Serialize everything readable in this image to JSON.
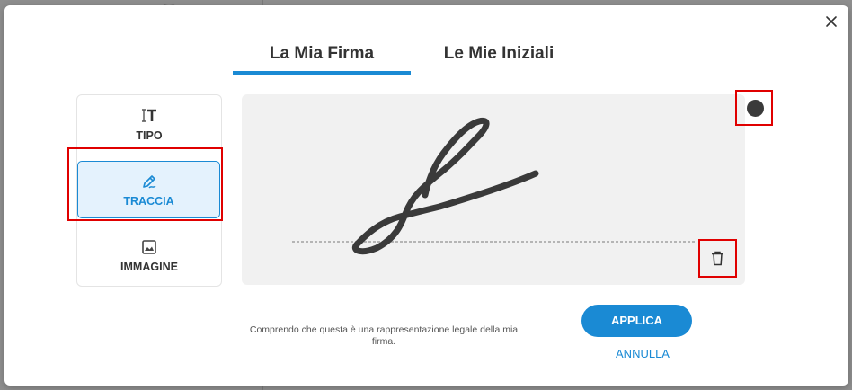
{
  "modal": {
    "tabs": [
      {
        "label": "La Mia Firma",
        "selected": true
      },
      {
        "label": "Le Mie Iniziali",
        "selected": false
      }
    ],
    "modes": [
      {
        "label": "TIPO",
        "icon": "text-type-icon",
        "selected": false
      },
      {
        "label": "TRACCIA",
        "icon": "draw-pen-icon",
        "selected": true
      },
      {
        "label": "IMMAGINE",
        "icon": "image-icon",
        "selected": false
      }
    ],
    "pen_color": "#3a3a3a",
    "legal_text": "Comprendo che questa è una rappresentazione legale della mia firma.",
    "apply_label": "APPLICA",
    "cancel_label": "ANNULLA"
  },
  "colors": {
    "accent": "#1a8ad4",
    "highlight": "#e00000",
    "canvas": "#f1f1f1"
  }
}
